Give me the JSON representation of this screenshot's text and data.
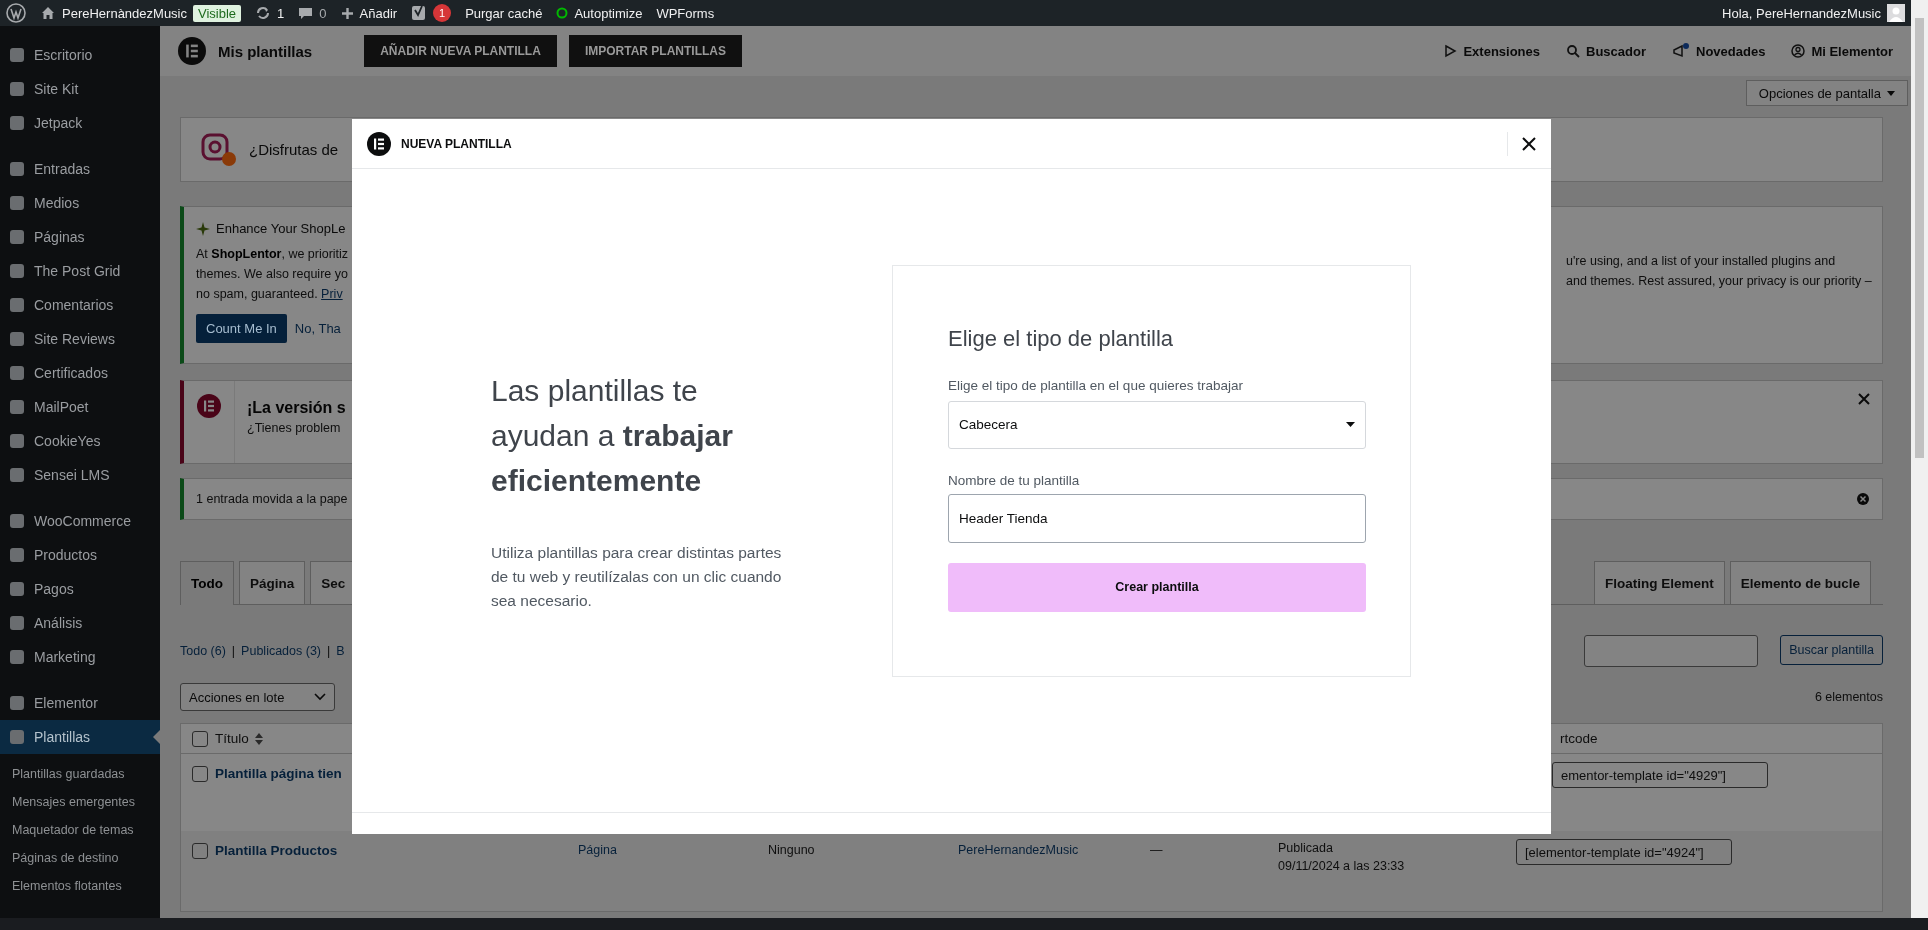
{
  "admin_bar": {
    "site": "PereHernàndezMusic",
    "badge": "Visible",
    "updates": "1",
    "comments": "0",
    "add": "Añadir",
    "seo_count": "1",
    "links": [
      "Purgar caché",
      "Autoptimize",
      "WPForms"
    ],
    "greeting": "Hola, PereHernandezMusic"
  },
  "sidebar": {
    "groups": [
      [
        {
          "label": "Escritorio",
          "selected": false
        },
        {
          "label": "Site Kit",
          "selected": false
        },
        {
          "label": "Jetpack",
          "selected": false
        }
      ],
      [
        {
          "label": "Entradas",
          "selected": false
        },
        {
          "label": "Medios",
          "selected": false
        },
        {
          "label": "Páginas",
          "selected": false
        },
        {
          "label": "The Post Grid",
          "selected": false
        },
        {
          "label": "Comentarios",
          "selected": false
        },
        {
          "label": "Site Reviews",
          "selected": false
        },
        {
          "label": "Certificados",
          "selected": false
        },
        {
          "label": "MailPoet",
          "selected": false
        },
        {
          "label": "CookieYes",
          "selected": false
        },
        {
          "label": "Sensei LMS",
          "selected": false
        }
      ],
      [
        {
          "label": "WooCommerce",
          "selected": false
        },
        {
          "label": "Productos",
          "selected": false
        },
        {
          "label": "Pagos",
          "selected": false
        },
        {
          "label": "Análisis",
          "selected": false
        },
        {
          "label": "Marketing",
          "selected": false
        }
      ],
      [
        {
          "label": "Elementor",
          "selected": false
        },
        {
          "label": "Plantillas",
          "selected": true,
          "children": [
            "Plantillas guardadas",
            "Mensajes emergentes",
            "Maquetador de temas",
            "Páginas de destino",
            "Elementos flotantes"
          ]
        }
      ]
    ]
  },
  "elementor_bar": {
    "title": "Mis plantillas",
    "buttons": [
      "AÑADIR NUEVA PLANTILLA",
      "IMPORTAR PLANTILLAS"
    ],
    "links": [
      {
        "label": "Extensiones",
        "kind": "play"
      },
      {
        "label": "Buscador",
        "kind": "search"
      },
      {
        "label": "Novedades",
        "kind": "megaphone"
      },
      {
        "label": "Mi Elementor",
        "kind": "user"
      }
    ]
  },
  "screen_options": "Opciones de pantalla",
  "review_notice": {
    "text": "¿Disfrutas de"
  },
  "shoplentor_notice": {
    "title": "Enhance Your ShopLe",
    "lines_left": [
      "At **ShopLentor**, we prioritiz",
      "themes. We also require yo"
    ],
    "line_3": "no spam, guaranteed.",
    "link": "Priv",
    "lines_right": [
      "u're using, and a list of your installed plugins and",
      "and themes. Rest assured, your privacy is our priority –"
    ],
    "primary": "Count Me In",
    "secondary": "No, Tha"
  },
  "elementor_notice": {
    "title": "¡La versión s",
    "text": "¿Tienes problem"
  },
  "trash_notice": {
    "text": "1 entrada movida a la pape"
  },
  "tabs_left": [
    {
      "label": "Todo",
      "selected": true
    },
    {
      "label": "Página",
      "selected": false
    },
    {
      "label": "Sec",
      "selected": false
    }
  ],
  "tabs_right": [
    {
      "label": "Floating Element",
      "selected": false
    },
    {
      "label": "Elemento de bucle",
      "selected": false
    }
  ],
  "filters": [
    "Todo (6)",
    "Publicados (3)",
    "B"
  ],
  "filter_separator": "|",
  "search_button": "Buscar plantilla",
  "bulk_action": "Acciones en lote",
  "item_count": "6 elementos",
  "table": {
    "header_checked": false,
    "title_column": "Título",
    "shortcode_column": "rtcode",
    "rows": [
      {
        "checked": false,
        "title": "Plantilla página tien",
        "shortcode": "ementor-template id=\"4929\"]"
      },
      {
        "checked": false,
        "title": "Plantilla Productos",
        "type": "Página",
        "conditions": "Ninguno",
        "author": "PereHernandezMusic",
        "column_6": "—",
        "status": "Publicada",
        "date": "09/11/2024 a las 23:33",
        "shortcode": "[elementor-template id=\"4924\"]"
      }
    ]
  },
  "modal": {
    "title": "NUEVA PLANTILLA",
    "headline": "Las plantillas te ayudan a **trabajar eficientemente**",
    "text": "Utiliza plantillas para crear distintas partes de tu web y reutilízalas con un clic cuando sea necesario.",
    "form_title": "Elige el tipo de plantilla",
    "type_label": "Elige el tipo de plantilla en el que quieres trabajar",
    "type_value": "Cabecera",
    "name_label": "Nombre de tu plantilla",
    "name_value": "Header Tienda",
    "submit": "Crear plantilla"
  }
}
